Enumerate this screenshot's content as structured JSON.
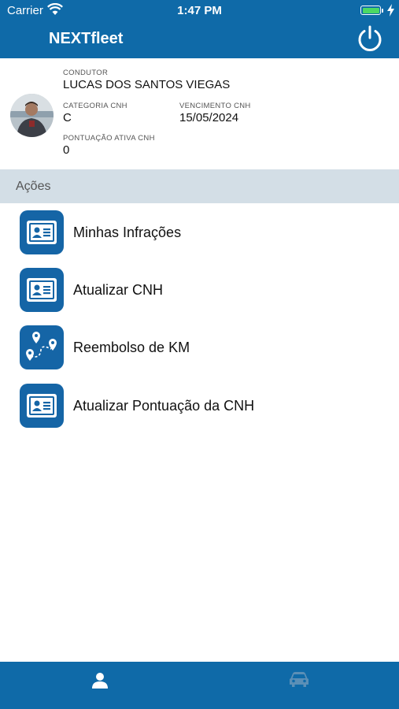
{
  "status_bar": {
    "carrier": "Carrier",
    "time": "1:47 PM",
    "battery_level": 1.0
  },
  "header": {
    "title": "NEXTfleet",
    "power_icon": "power-icon"
  },
  "profile": {
    "driver_label": "CONDUTOR",
    "driver_name": "LUCAS DOS SANTOS VIEGAS",
    "category_label": "CATEGORIA CNH",
    "category_value": "C",
    "expiry_label": "VENCIMENTO CNH",
    "expiry_value": "15/05/2024",
    "points_label": "PONTUAÇÃO ATIVA CNH",
    "points_value": "0"
  },
  "actions_section": {
    "title": "Ações",
    "items": [
      {
        "label": "Minhas Infrações",
        "icon": "id-card-icon"
      },
      {
        "label": "Atualizar CNH",
        "icon": "id-card-icon"
      },
      {
        "label": "Reembolso de KM",
        "icon": "map-route-icon"
      },
      {
        "label": "Atualizar Pontuação da CNH",
        "icon": "id-card-icon"
      }
    ]
  },
  "tabbar": {
    "tabs": [
      {
        "icon": "person-icon",
        "active": true
      },
      {
        "icon": "car-icon",
        "active": false
      }
    ]
  },
  "colors": {
    "primary": "#0f6aa8",
    "icon_tile": "#1565a6",
    "section_bg": "#d3dee6",
    "battery": "#4cd964",
    "inactive_tab": "#5b8fb6"
  }
}
